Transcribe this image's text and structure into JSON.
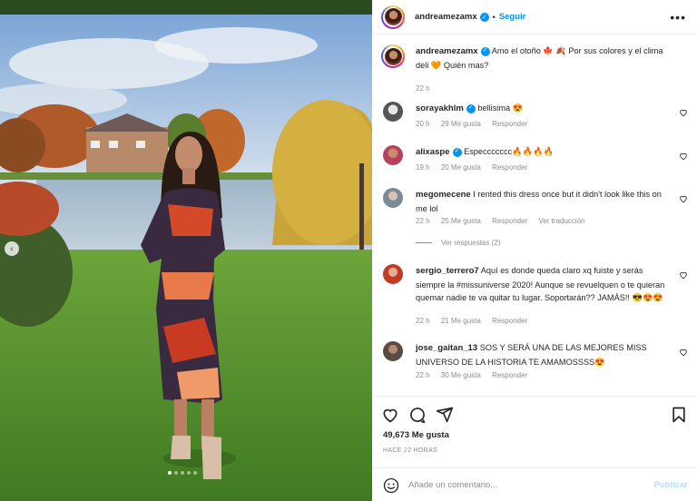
{
  "post": {
    "username": "andreamezamx",
    "follow_label": "Seguir",
    "caption": "Amo el otoño 🍁 🍂 Por sus colores y el clima deli 🧡 Quién mas?",
    "caption_time": "22 h"
  },
  "comments": [
    {
      "user": "sorayakhlm",
      "verified": true,
      "text": "bellisima 😍",
      "time": "20 h",
      "likes": "29 Me gusta",
      "reply": "Responder"
    },
    {
      "user": "alixaspe",
      "verified": true,
      "text": "Especcccccc🔥🔥🔥🔥",
      "time": "19 h",
      "likes": "20 Me gusta",
      "reply": "Responder"
    },
    {
      "user": "megomecene",
      "verified": false,
      "text": "I rented this dress once but it didn't look like this on me lol",
      "time": "22 h",
      "likes": "25 Me gusta",
      "reply": "Responder",
      "translate": "Ver traducción",
      "view_replies": "Ver respuestas (2)"
    },
    {
      "user": "sergio_terrero7",
      "verified": false,
      "text": "Aquí es donde queda claro xq fuiste y serás siempre la #missuniverse 2020! Aunque se revuelquen o te quieran quemar nadie te va quitar tu lugar. Soportarán?? JAMÁS!! 😎😍😍",
      "time": "22 h",
      "likes": "21 Me gusta",
      "reply": "Responder"
    },
    {
      "user": "jose_gaitan_13",
      "verified": false,
      "text": "SOS Y SERÁ UNA DE LAS MEJORES MISS UNIVERSO DE LA HISTORIA TE AMAMOSSSS😍",
      "time": "22 h",
      "likes": "30 Me gusta",
      "reply": "Responder"
    }
  ],
  "stats": {
    "likes": "49,673 Me gusta",
    "ago": "HACE 22 HORAS"
  },
  "add_comment": {
    "placeholder": "Añade un comentario...",
    "publish": "Publicar"
  },
  "icons": [
    "heart-icon",
    "comment-icon",
    "share-icon",
    "bookmark-icon",
    "more-icon",
    "emoji-icon",
    "chevron-left-icon",
    "verified-icon"
  ],
  "colors": {
    "link": "#0095f6",
    "muted": "#8e8e8e",
    "text": "#262626",
    "publish_disabled": "#b2dffc"
  }
}
